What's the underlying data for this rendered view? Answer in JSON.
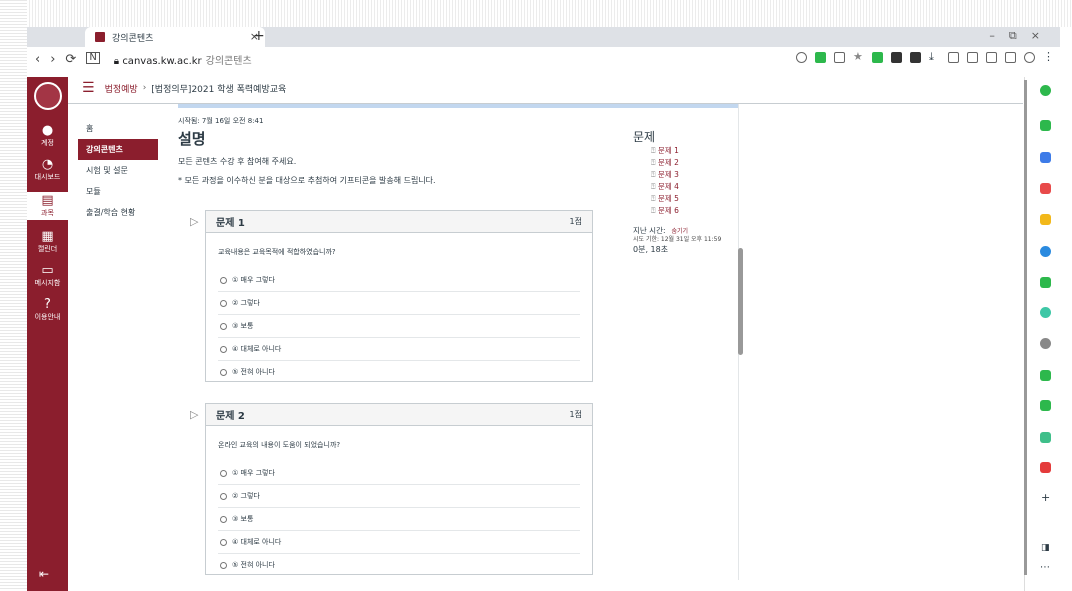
{
  "browser": {
    "tab_title": "강의콘텐츠",
    "url_host": "canvas.kw.ac.kr",
    "url_path": "강의콘텐츠"
  },
  "global_nav": {
    "items": [
      {
        "label": "계정",
        "icon": "account-icon"
      },
      {
        "label": "대시보드",
        "icon": "dashboard-icon"
      },
      {
        "label": "과목",
        "icon": "courses-icon"
      },
      {
        "label": "캘린더",
        "icon": "calendar-icon"
      },
      {
        "label": "메시지함",
        "icon": "inbox-icon"
      },
      {
        "label": "이용안내",
        "icon": "help-icon"
      }
    ]
  },
  "breadcrumb": {
    "course": "법정예방",
    "page": "[법정의무]2021 학생 폭력예방교육"
  },
  "course_nav": {
    "items": [
      "홈",
      "강의콘텐츠",
      "시험 및 설문",
      "모듈",
      "출결/학습 현황"
    ]
  },
  "quiz": {
    "started": "시작됨: 7월 16일 오전 8:41",
    "title": "설명",
    "instructions_1": "모든 콘텐츠 수강 후 참여해 주세요.",
    "instructions_2": "* 모든 과정을 이수하신 분을 대상으로 추첨하여 기프티콘을 발송해 드립니다.",
    "questions": [
      {
        "title": "문제 1",
        "points": "1점",
        "text": "교육내용은 교육목적에 적합하였습니까?",
        "options": [
          "① 매우 그렇다",
          "② 그렇다",
          "③ 보통",
          "④ 대체로 아니다",
          "⑤ 전혀 아니다"
        ]
      },
      {
        "title": "문제 2",
        "points": "1점",
        "text": "온라인 교육의 내용이 도움이 되었습니까?",
        "options": [
          "① 매우 그렇다",
          "② 그렇다",
          "③ 보통",
          "④ 대체로 아니다",
          "⑤ 전혀 아니다"
        ]
      }
    ]
  },
  "side_panel": {
    "heading": "문제",
    "questions": [
      "문제 1",
      "문제 2",
      "문제 3",
      "문제 4",
      "문제 5",
      "문제 6"
    ],
    "time_label": "지난 시간:",
    "hide_label": "숨기기",
    "deadline": "시도 기한: 12월 31일 오후 11:59",
    "elapsed": "0분, 18초"
  },
  "colors": {
    "brand": "#8b1e2d"
  }
}
